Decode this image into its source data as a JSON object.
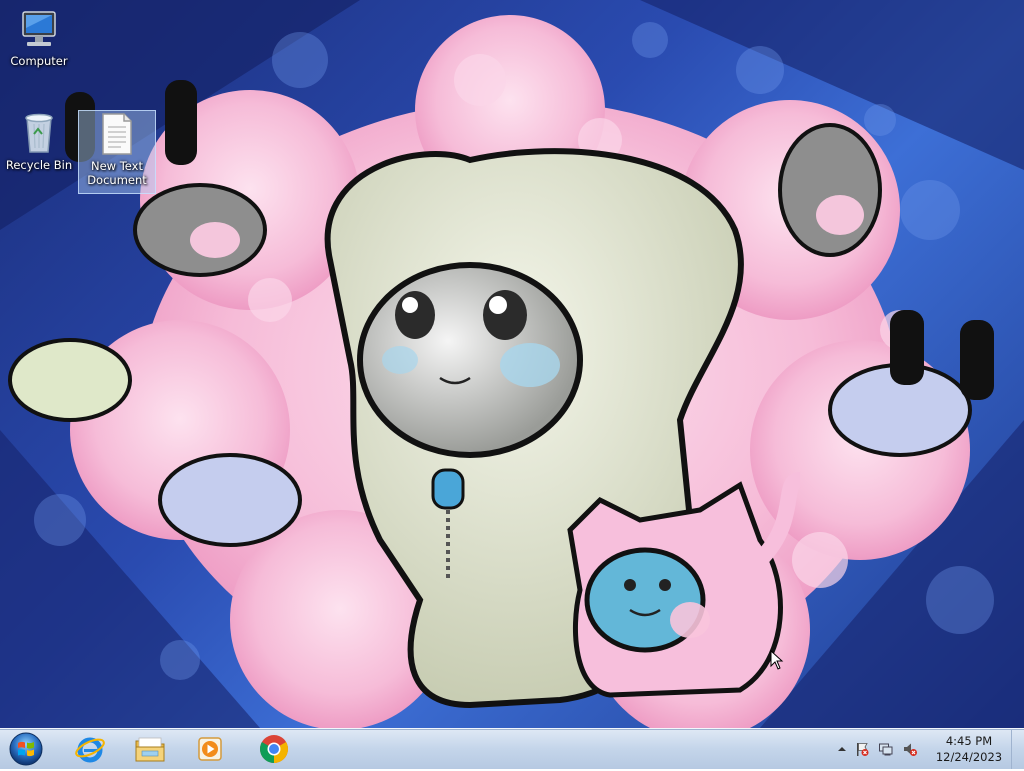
{
  "desktop": {
    "icons": [
      {
        "label": "Computer"
      },
      {
        "label": "Recycle Bin"
      },
      {
        "label": "New Text Document"
      }
    ]
  },
  "taskbar": {
    "start": {
      "icon": "windows-logo-icon"
    },
    "pinned": [
      {
        "icon": "internet-explorer-icon"
      },
      {
        "icon": "file-explorer-icon"
      },
      {
        "icon": "media-player-icon"
      },
      {
        "icon": "chrome-icon"
      }
    ],
    "tray": {
      "icons": [
        "show-hidden-icons-arrow",
        "action-center-flag-icon",
        "network-icon",
        "volume-muted-icon"
      ]
    },
    "clock": {
      "time": "4:45 PM",
      "date": "12/24/2023"
    }
  },
  "colors": {
    "taskbar": "#c4d5ea",
    "wallpaper_blue": "#2a4bb0",
    "wallpaper_pink": "#f4b8d6"
  }
}
